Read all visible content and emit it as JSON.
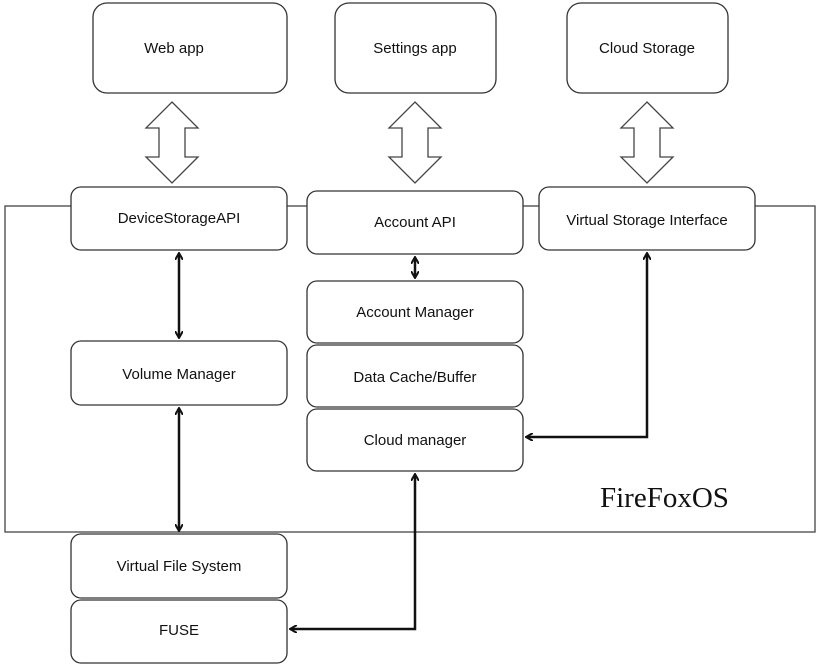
{
  "apps": {
    "web_app": "Web app",
    "settings_app": "Settings app",
    "cloud_storage": "Cloud Storage"
  },
  "apis": {
    "device_storage_api": "DeviceStorageAPI",
    "account_api": "Account API",
    "virtual_storage_interface": "Virtual Storage Interface"
  },
  "components": {
    "volume_manager": "Volume Manager",
    "account_manager": "Account Manager",
    "data_cache": "Data Cache/Buffer",
    "cloud_manager": "Cloud manager",
    "virtual_file_system": "Virtual File System",
    "fuse": "FUSE"
  },
  "os_label": "FireFoxOS"
}
